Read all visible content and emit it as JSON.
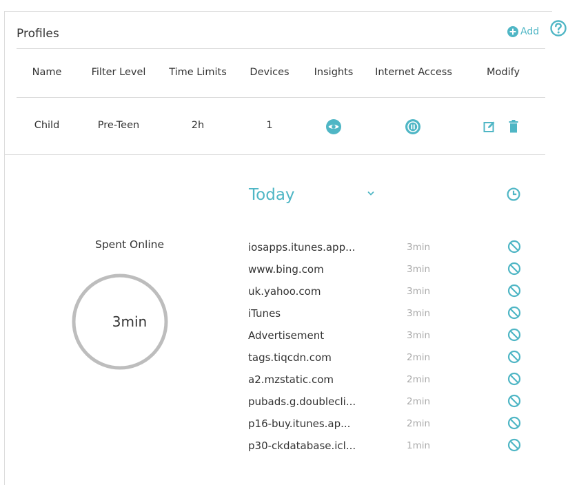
{
  "page": {
    "title": "Profiles",
    "add_label": "Add"
  },
  "colors": {
    "accent": "#4fb6c5",
    "donut_ring": "#bdbdbd",
    "muted_text": "#aaaaaa",
    "divider": "#dcdcdc"
  },
  "table": {
    "headers": [
      "Name",
      "Filter Level",
      "Time Limits",
      "Devices",
      "Insights",
      "Internet Access",
      "Modify"
    ],
    "rows": [
      {
        "name": "Child",
        "filter_level": "Pre-Teen",
        "time_limits": "2h",
        "devices": "1",
        "insights_icon": "eye-icon",
        "internet_access_icon": "pause-icon",
        "modify_icons": [
          "edit-icon",
          "trash-icon"
        ]
      }
    ]
  },
  "insights": {
    "period": "Today",
    "spent_label": "Spent Online",
    "spent_value": "3min",
    "sites": [
      {
        "name": "iosapps.itunes.app...",
        "duration": "3min"
      },
      {
        "name": "www.bing.com",
        "duration": "3min"
      },
      {
        "name": "uk.yahoo.com",
        "duration": "3min"
      },
      {
        "name": "iTunes",
        "duration": "3min"
      },
      {
        "name": "Advertisement",
        "duration": "3min"
      },
      {
        "name": "tags.tiqcdn.com",
        "duration": "2min"
      },
      {
        "name": "a2.mzstatic.com",
        "duration": "2min"
      },
      {
        "name": "pubads.g.doublecli...",
        "duration": "2min"
      },
      {
        "name": "p16-buy.itunes.ap...",
        "duration": "2min"
      },
      {
        "name": "p30-ckdatabase.icl...",
        "duration": "1min"
      }
    ]
  }
}
